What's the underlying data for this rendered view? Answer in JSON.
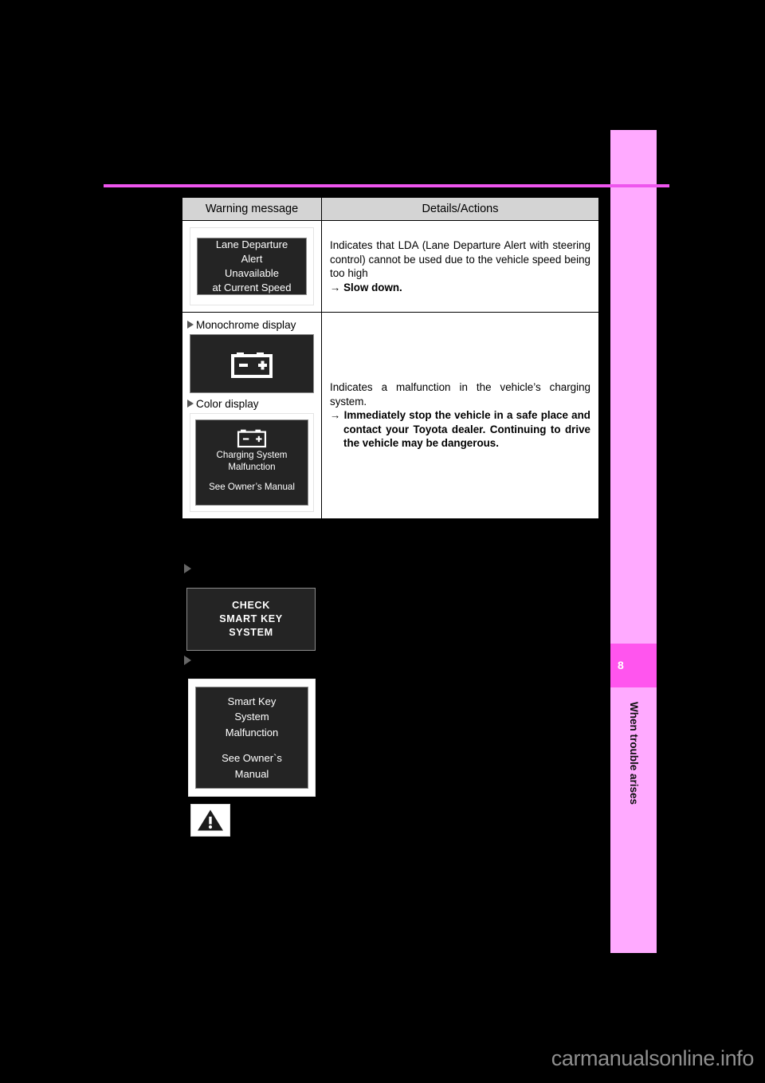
{
  "page": {
    "background_color": "#000000",
    "rule_color": "#ee55ee"
  },
  "sidebar": {
    "chapter_number": "8",
    "chapter_title": "When trouble arises",
    "tab_color": "#ffaaff",
    "number_badge_color": "#ff55ee"
  },
  "table": {
    "headers": {
      "message": "Warning message",
      "details": "Details/Actions"
    },
    "rows": [
      {
        "display_panels": [
          {
            "kind": "text-panel",
            "lines": [
              "Lane Departure",
              "Alert",
              "Unavailable",
              "at Current Speed"
            ]
          }
        ],
        "details": {
          "body": "Indicates that LDA (Lane Departure Alert with steering control) cannot be used due to the vehicle speed being too high",
          "arrow": "→",
          "action": "Slow down."
        }
      },
      {
        "display_panels": [
          {
            "kind": "icon-panel",
            "caption": "Monochrome display",
            "icon": "battery-icon"
          },
          {
            "kind": "icon-text-panel",
            "caption": "Color display",
            "icon": "battery-icon",
            "lines": [
              "Charging System",
              "Malfunction"
            ],
            "footer": "See Owner’s Manual"
          }
        ],
        "details": {
          "body": "Indicates a malfunction in the vehicle’s charging system.",
          "arrow": "→",
          "action": "Immediately stop the vehicle in a safe place and contact your Toyota dealer. Continuing to drive the vehicle may be dangerous."
        }
      }
    ]
  },
  "standalone": {
    "bullet_1": "",
    "check_smart_key_panel": {
      "lines": [
        "CHECK",
        "SMART KEY",
        "SYSTEM"
      ]
    },
    "bullet_2": "",
    "smart_key_panel": {
      "lines": [
        "Smart Key",
        "System",
        "Malfunction"
      ],
      "footer_lines": [
        "See Owner`s",
        "Manual"
      ]
    },
    "warning_icon": "warning-triangle-icon"
  },
  "footer": {
    "watermark": "carmanualsonline.info"
  }
}
